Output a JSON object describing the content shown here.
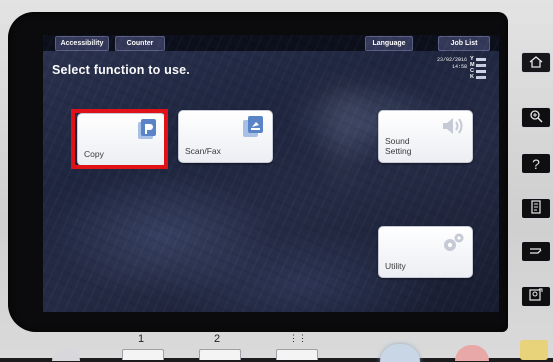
{
  "top_tabs": [
    {
      "label": "Accessibility"
    },
    {
      "label": "Counter"
    },
    {
      "label": "Language"
    },
    {
      "label": "Job List"
    }
  ],
  "screen": {
    "title": "Select function to use.",
    "date": "23/02/2016",
    "time": "14:58",
    "toner": [
      "Y",
      "M",
      "C",
      "K"
    ]
  },
  "tiles": [
    {
      "label": "Copy",
      "icon": "copy-icon",
      "highlighted": true
    },
    {
      "label": "Scan/Fax",
      "icon": "scan-fax-icon"
    },
    {
      "label": "Sound\nSetting",
      "icon": "speaker-icon"
    },
    {
      "label": "Utility",
      "icon": "gears-icon"
    }
  ],
  "side_buttons": [
    {
      "icon": "home-icon"
    },
    {
      "icon": "zoom-icon"
    },
    {
      "icon": "help-icon",
      "label": "?"
    },
    {
      "icon": "document-icon"
    },
    {
      "icon": "return-icon"
    },
    {
      "icon": "accessibility-icon"
    }
  ],
  "keypad": {
    "keys": [
      "1",
      "2",
      "⋮⋮"
    ]
  },
  "colors": {
    "highlight": "#e01218",
    "tile_bg": "#ffffff",
    "icon_blue": "#5b84c8"
  }
}
